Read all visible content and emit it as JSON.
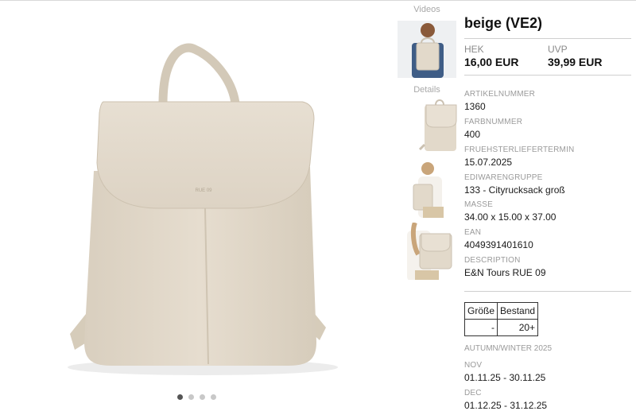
{
  "thumbnails": {
    "videos_label": "Videos",
    "details_label": "Details"
  },
  "carousel": {
    "count": 4,
    "active": 0
  },
  "product": {
    "title": "beige (VE2)",
    "brand_mark": "RUE 09",
    "colors": {
      "bag": "#e2d9ca",
      "bag_shadow": "#cbc1b1"
    }
  },
  "prices": {
    "hek_label": "HEK",
    "hek_value": "16,00 EUR",
    "uvp_label": "UVP",
    "uvp_value": "39,99 EUR"
  },
  "fields": [
    {
      "label": "ARTIKELNUMMER",
      "value": "1360"
    },
    {
      "label": "FARBNUMMER",
      "value": "400"
    },
    {
      "label": "FRUEHSTERLIEFERTERMIN",
      "value": "15.07.2025"
    },
    {
      "label": "EDIWARENGRUPPE",
      "value": "133 - Cityrucksack groß"
    },
    {
      "label": "MASSE",
      "value": "34.00 x 15.00 x 37.00"
    },
    {
      "label": "EAN",
      "value": "4049391401610"
    },
    {
      "label": "DESCRIPTION",
      "value": "E&N Tours RUE 09"
    }
  ],
  "stock": {
    "headers": [
      "Größe",
      "Bestand"
    ],
    "rows": [
      [
        "-",
        "20+"
      ]
    ]
  },
  "season": {
    "label": "AUTUMN/WINTER 2025",
    "periods": [
      {
        "month": "NOV",
        "range": "01.11.25 - 30.11.25"
      },
      {
        "month": "DEC",
        "range": "01.12.25 - 31.12.25"
      }
    ]
  }
}
